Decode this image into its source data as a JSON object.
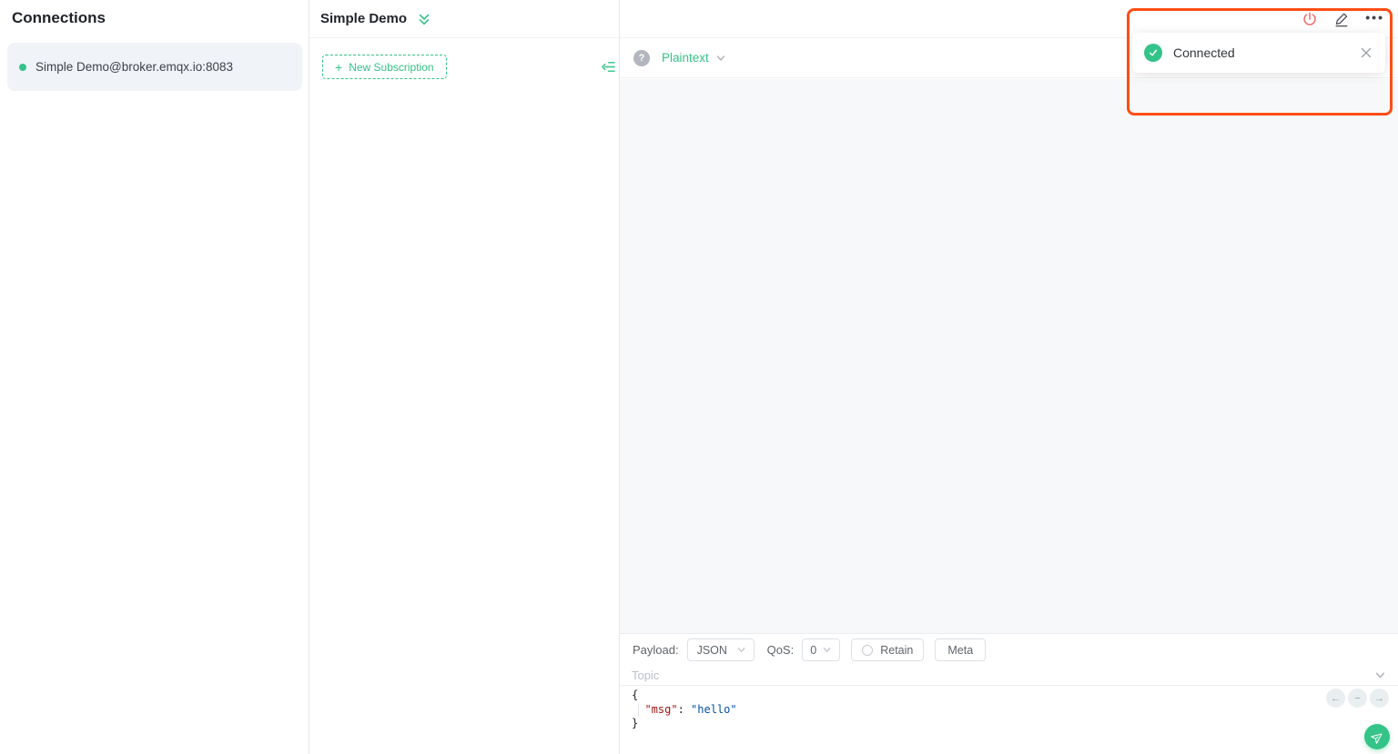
{
  "colors": {
    "accent_green": "#34c388",
    "danger_red": "#f56c6c",
    "annotation_orange": "#ff4e16",
    "code_key_red": "#a31515",
    "code_string_blue": "#0451a5"
  },
  "sidebar": {
    "title": "Connections",
    "connection": {
      "label": "Simple Demo@broker.emqx.io:8083",
      "status": "connected"
    }
  },
  "subscriptions": {
    "title": "Simple Demo",
    "new_subscription": {
      "plus": "+",
      "label": "New Subscription"
    }
  },
  "toolbar": {
    "more_glyph": "•••"
  },
  "format_bar": {
    "help_glyph": "?",
    "format": "Plaintext"
  },
  "publish": {
    "payload_label": "Payload:",
    "payload_type": "JSON",
    "qos_label": "QoS:",
    "qos_value": "0",
    "retain_label": "Retain",
    "meta_label": "Meta",
    "topic_placeholder": "Topic"
  },
  "editor": {
    "open_brace": "{",
    "indent": "  ",
    "key": "\"msg\"",
    "colon": ": ",
    "value": "\"hello\"",
    "close_brace": "}",
    "nav": {
      "prev": "←",
      "collapse": "−",
      "next": "→"
    }
  },
  "notification": {
    "status": "Connected"
  }
}
